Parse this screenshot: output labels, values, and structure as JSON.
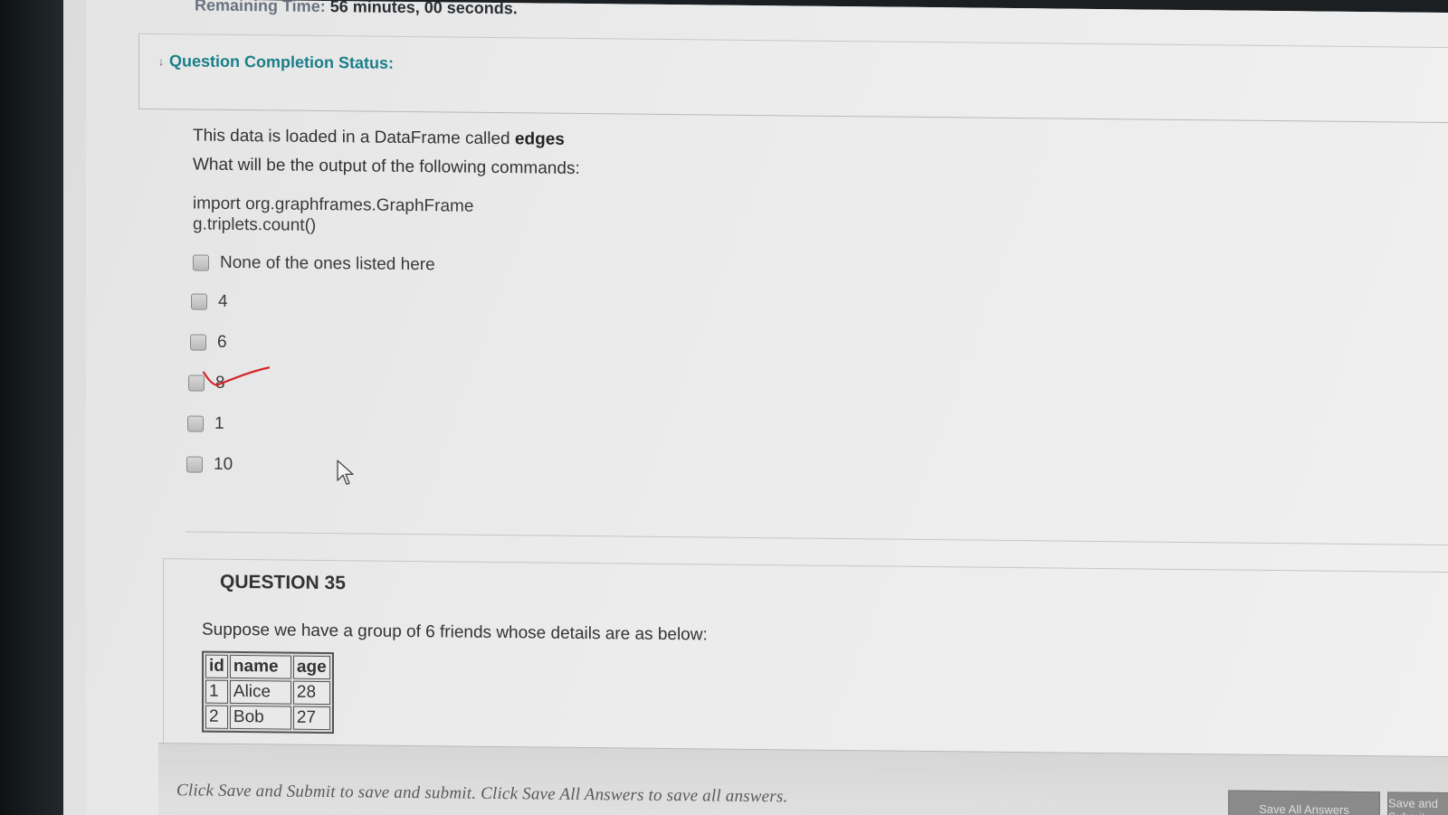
{
  "timer": {
    "label": "Remaining Time:",
    "value": "56 minutes, 00 seconds."
  },
  "status": {
    "heading": "Question Completion Status:"
  },
  "question34": {
    "line1_prefix": "This data is loaded in a DataFrame called ",
    "line1_bold": "edges",
    "line2": "What will be the output of the following commands:",
    "code": [
      "import org.graphframes.GraphFrame",
      "g.triplets.count()"
    ],
    "options": [
      "None of the ones listed here",
      "4",
      "6",
      "8",
      "1",
      "10"
    ]
  },
  "question35": {
    "title": "QUESTION 35",
    "text": "Suppose we have a group of 6 friends whose details are as below:",
    "table": {
      "headers": [
        "id",
        "name",
        "age"
      ],
      "rows": [
        [
          "1",
          "Alice",
          "28"
        ],
        [
          "2",
          "Bob",
          "27"
        ]
      ]
    }
  },
  "footer": {
    "text": "Click Save and Submit to save and submit. Click Save All Answers to save all answers.",
    "save_all_label": "Save All Answers",
    "submit_label": "Save and Submit"
  }
}
